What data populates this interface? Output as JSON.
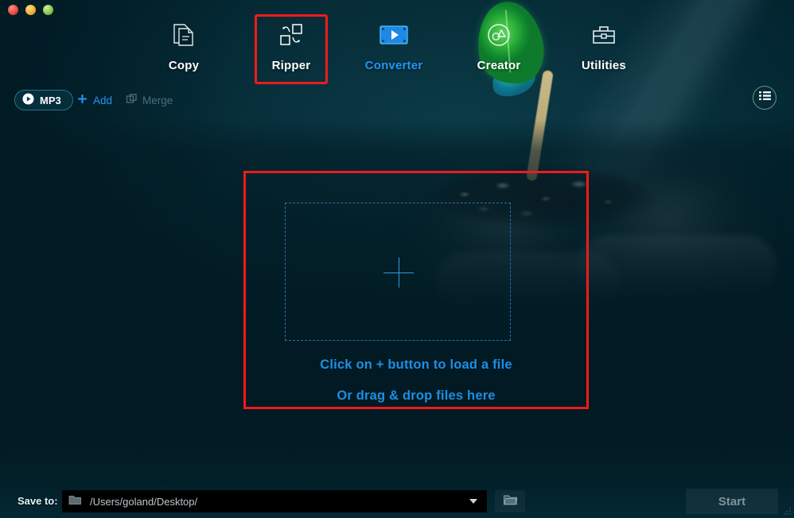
{
  "window": {
    "traffic_lights": [
      {
        "name": "close",
        "color": "#e0443c"
      },
      {
        "name": "minimize",
        "color": "#f0a92c"
      },
      {
        "name": "zoom",
        "color": "#7cbf47"
      }
    ]
  },
  "nav": {
    "items": [
      {
        "id": "copy",
        "label": "Copy",
        "icon": "documents-copy-icon",
        "active": false,
        "highlighted": false
      },
      {
        "id": "ripper",
        "label": "Ripper",
        "icon": "rip-convert-icon",
        "active": false,
        "highlighted": true
      },
      {
        "id": "converter",
        "label": "Converter",
        "icon": "film-play-icon",
        "active": true,
        "highlighted": false
      },
      {
        "id": "creator",
        "label": "Creator",
        "icon": "creator-circle-icon",
        "active": false,
        "highlighted": false
      },
      {
        "id": "utilities",
        "label": "Utilities",
        "icon": "toolbox-icon",
        "active": false,
        "highlighted": false
      }
    ]
  },
  "toolbar": {
    "format_chip": {
      "label": "MP3",
      "icon": "play-circle-icon"
    },
    "add": {
      "label": "Add",
      "icon": "plus-icon"
    },
    "merge": {
      "label": "Merge",
      "icon": "merge-icon",
      "disabled": true
    },
    "list_view": {
      "icon": "list-icon"
    }
  },
  "dropzone": {
    "plus_icon": "plus-icon",
    "line1": "Click on + button to load a file",
    "line2": "Or drag & drop files here"
  },
  "bottom": {
    "save_to_label": "Save to:",
    "path_value": "/Users/goland/Desktop/",
    "path_icon": "folder-icon",
    "dropdown_icon": "chevron-down-icon",
    "browse_icon": "folder-open-icon",
    "start_label": "Start"
  },
  "colors": {
    "accent_blue": "#2196f3",
    "highlight_red": "#ee1b1b",
    "background_dark": "#011a23",
    "header_teal": "#0a4250",
    "dropzone_text": "#1e8ee4",
    "disabled_text": "#4a6d7c"
  }
}
